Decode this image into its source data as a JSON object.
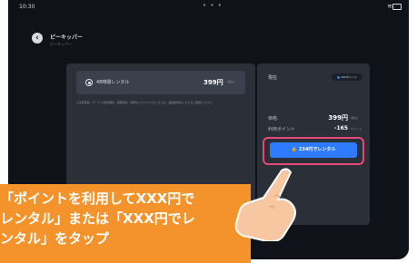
{
  "status_bar": {
    "time": "10:30",
    "dots": "• • •"
  },
  "header": {
    "back_icon": "chevron-left-icon",
    "title": "ピーキッパー",
    "subtitle": "ピーキッパー"
  },
  "left_panel": {
    "option": {
      "label": "48時間レンタル",
      "price": "399円",
      "tax": "(税込)"
    },
    "notes": "※注意事項。サービス提供期間、視聴環境・制限などについてはこちらを、返品規約はこちらをご確認ください。"
  },
  "right_panel": {
    "current_label": "現在",
    "points_badge": "165ポイント",
    "price_label": "価格",
    "price_value": "399円",
    "price_tax": "(税込)",
    "use_points_label": "利用ポイント",
    "use_points_value": "-165",
    "use_points_unit": "ポイント",
    "cta_label": "234円でレンタル",
    "cta_icon": "lock-icon"
  },
  "annotation": {
    "line1": "「ポイントを利用してXXX円で",
    "line2": "レンタル」または「XXX円でレ",
    "line3": "ンタル」をタップ"
  },
  "colors": {
    "accent": "#2f7bff",
    "highlight": "#e54a7a",
    "callout": "#f4932b",
    "background": "#0f1218",
    "panel": "#2a2f38"
  }
}
